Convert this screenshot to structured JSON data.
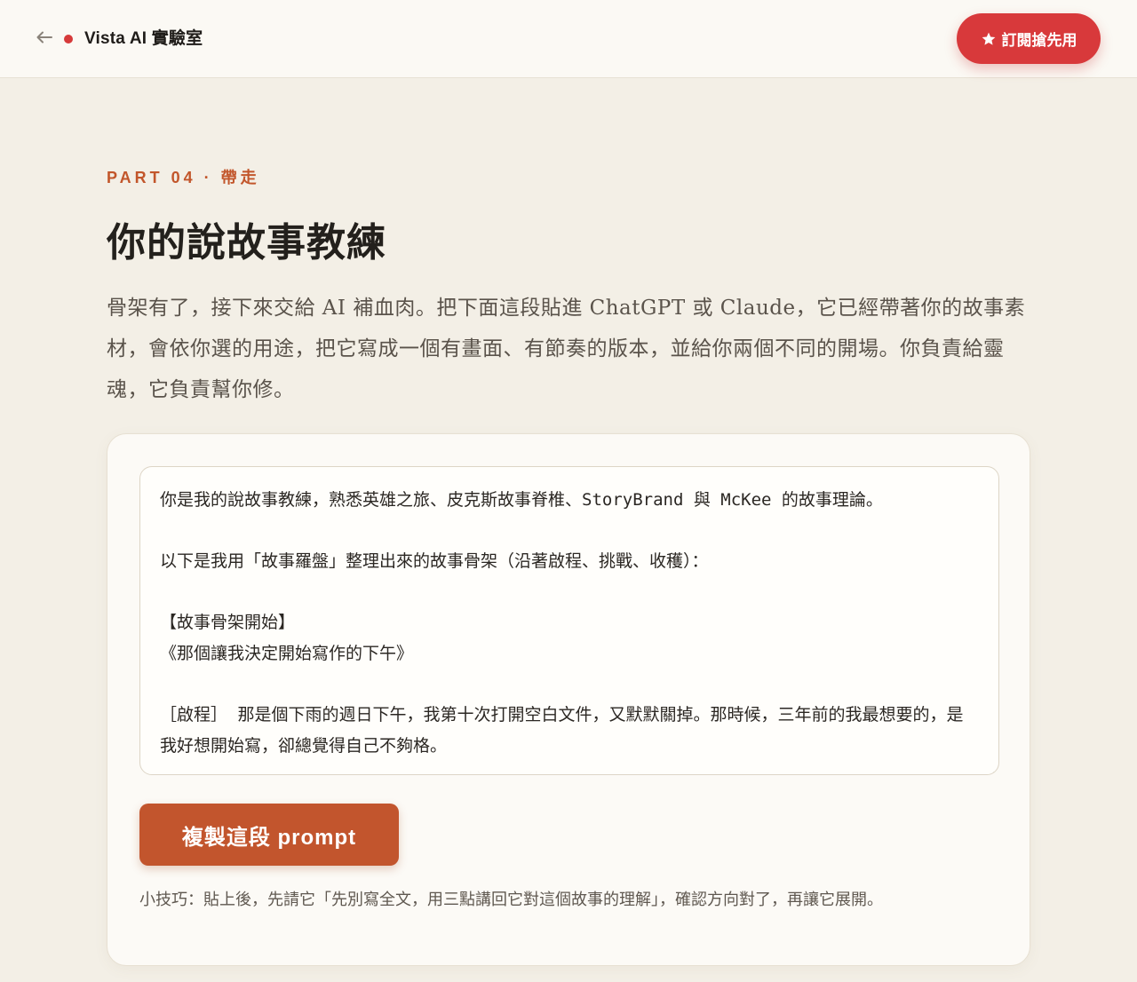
{
  "header": {
    "brand": "Vista AI 實驗室",
    "subscribe_label": "訂閱搶先用",
    "accent_color": "#d8393b"
  },
  "section": {
    "eyebrow": "PART 04 · 帶走",
    "title": "你的說故事教練",
    "intro": "骨架有了，接下來交給 AI 補血肉。把下面這段貼進 ChatGPT 或 Claude，它已經帶著你的故事素材，會依你選的用途，把它寫成一個有畫面、有節奏的版本，並給你兩個不同的開場。你負責給靈魂，它負責幫你修。",
    "accent_color": "#c2562b"
  },
  "prompt": {
    "line1": "你是我的說故事教練，熟悉英雄之旅、皮克斯故事脊椎、StoryBrand 與 McKee 的故事理論。",
    "line2": "以下是我用「故事羅盤」整理出來的故事骨架（沿著啟程、挑戰、收穫）：",
    "line3": "【故事骨架開始】",
    "line4": "《那個讓我決定開始寫作的下午》",
    "line5": "［啟程］ 那是個下雨的週日下午，我第十次打開空白文件，又默默關掉。那時候，三年前的我最想要的，是我好想開始寫，卻總覺得自己不夠格。",
    "copy_label": "複製這段 prompt",
    "tip": "小技巧：貼上後，先請它「先別寫全文，用三點講回它對這個故事的理解」，確認方向對了，再讓它展開。"
  },
  "icons": {
    "back": "arrow-left-icon",
    "live": "status-dot-icon",
    "star": "star-icon",
    "resize": "resize-grip-icon"
  }
}
